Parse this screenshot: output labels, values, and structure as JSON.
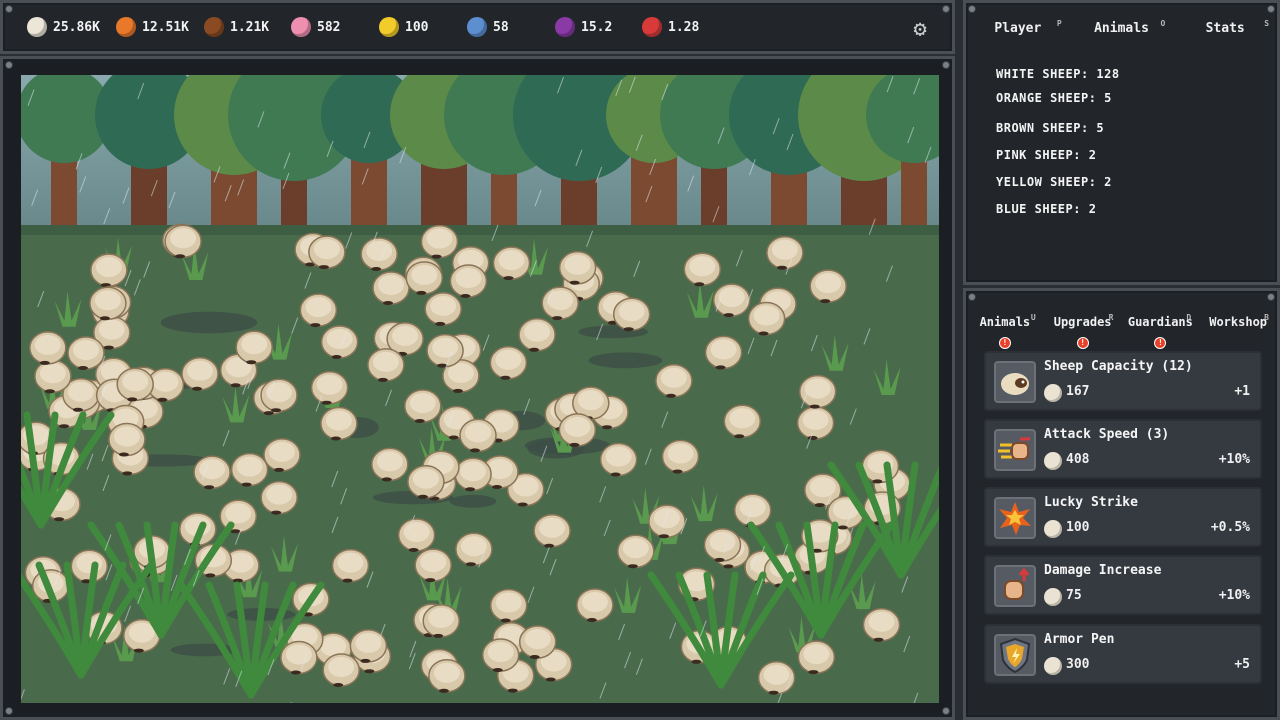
{
  "resources": [
    {
      "name": "white-wool",
      "value": "25.86K",
      "color": "#ece6d8"
    },
    {
      "name": "orange-wool",
      "value": "12.51K",
      "color": "#e8782a"
    },
    {
      "name": "brown-wool",
      "value": "1.21K",
      "color": "#8a4a22"
    },
    {
      "name": "pink-wool",
      "value": "582",
      "color": "#ee8fb0"
    },
    {
      "name": "yellow-wool",
      "value": "100",
      "color": "#f2cc2a"
    },
    {
      "name": "blue-wool",
      "value": "58",
      "color": "#5c8ed0"
    },
    {
      "name": "purple-wool",
      "value": "15.2",
      "color": "#8a3aa6"
    },
    {
      "name": "red-wool",
      "value": "1.28",
      "color": "#d83a3a"
    }
  ],
  "info_tabs": [
    {
      "label": "Player",
      "hotkey": "P"
    },
    {
      "label": "Animals",
      "hotkey": "O"
    },
    {
      "label": "Stats",
      "hotkey": "S"
    }
  ],
  "animal_counts": [
    "WHITE SHEEP: 128",
    "ORANGE SHEEP: 5",
    "BROWN SHEEP: 5",
    "PINK SHEEP: 2",
    "YELLOW SHEEP: 2",
    "BLUE SHEEP: 2"
  ],
  "shop_tabs": [
    {
      "label": "Animals",
      "hotkey": "U",
      "alert": true
    },
    {
      "label": "Upgrades",
      "hotkey": "R",
      "alert": true
    },
    {
      "label": "Guardians",
      "hotkey": "D",
      "alert": true
    },
    {
      "label": "Workshop",
      "hotkey": "B",
      "alert": false
    }
  ],
  "upgrades": [
    {
      "title": "Sheep Capacity (12)",
      "cost": "167",
      "bonus": "+1",
      "icon": "sheep-icon"
    },
    {
      "title": "Attack Speed (3)",
      "cost": "408",
      "bonus": "+10%",
      "icon": "fist-speed-icon"
    },
    {
      "title": "Lucky Strike",
      "cost": "100",
      "bonus": "+0.5%",
      "icon": "explosion-icon"
    },
    {
      "title": "Damage Increase",
      "cost": "75",
      "bonus": "+10%",
      "icon": "fist-up-icon"
    },
    {
      "title": "Armor Pen",
      "cost": "300",
      "bonus": "+5",
      "icon": "shield-icon"
    }
  ]
}
